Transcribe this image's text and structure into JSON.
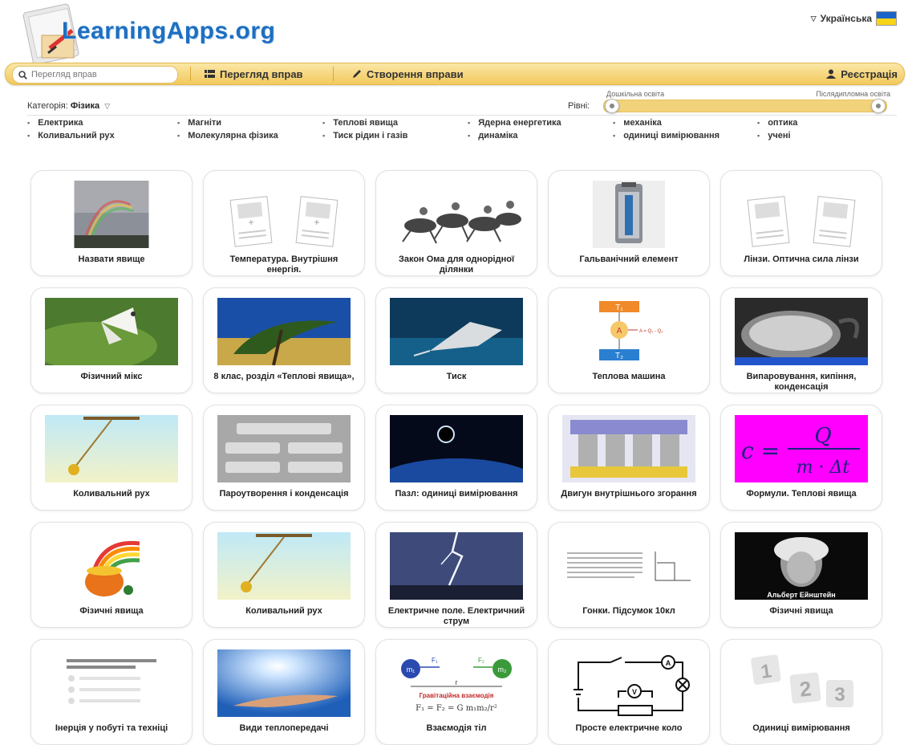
{
  "header": {
    "logo_text": "LearningApps.org",
    "language": "Українська"
  },
  "navbar": {
    "search_placeholder": "Перегляд вправ",
    "browse_label": "Перегляд вправ",
    "create_label": "Створення вправи",
    "register_label": "Реєстрація"
  },
  "filters": {
    "category_label": "Категорія:",
    "category_value": "Фізика",
    "levels_label": "Рівні:",
    "level_min_label": "Дошкільна освіта",
    "level_max_label": "Післядипломна освіта"
  },
  "topics": [
    "Електрика",
    "Магніти",
    "Теплові явища",
    "Ядерна енергетика",
    "механіка",
    "оптика",
    "Коливальний рух",
    "Молекулярна фізика",
    "Тиск рідин і газів",
    "динаміка",
    "одиниці вимірювання",
    "учені"
  ],
  "cards": [
    "Назвати явище",
    "Температура. Внутрішня енергія.",
    "Закон Ома для однорідної ділянки",
    "Гальванічний елемент",
    "Лінзи. Оптична сила лінзи",
    "Фізичний мікс",
    "8 клас, розділ «Теплові явища»,",
    "Тиск",
    "Теплова машина",
    "Випаровування, кипіння, конденсація",
    "Коливальний рух",
    "Пароутворення і конденсація",
    "Пазл: одиниці вимірювання",
    "Двигун внутрішнього згорання",
    "Формули. Теплові явища",
    "Фізичні явища",
    "Коливальний рух",
    "Електричне поле. Електричний струм",
    "Гонки. Підсумок 10кл",
    "Фізичні явища",
    "Інерція у побуті та техніці",
    "Види теплопередачі",
    "Взаємодія тіл",
    "Просте електричне коло",
    "Одиниці вимірювання"
  ],
  "thumb_text": {
    "heat_t1": "T₁",
    "heat_t2": "T₂",
    "heat_a": "A",
    "heat_formula": "A = Q₁ - Q₂",
    "formula_c": "c =",
    "formula_q": "Q",
    "formula_den": "m · Δt",
    "einstein_caption": "Альберт Ейнштейн",
    "grav_title": "Гравітаційна взаємодія",
    "grav_formula": "F₁ = F₂ = G m₁m₂/r²",
    "grav_m1": "m₁",
    "grav_m2": "m₂",
    "grav_f1": "F₁",
    "grav_f2": "F₂",
    "grav_r": "r",
    "meter_a": "A",
    "meter_v": "V",
    "num_1": "1",
    "num_2": "2",
    "num_3": "3"
  }
}
